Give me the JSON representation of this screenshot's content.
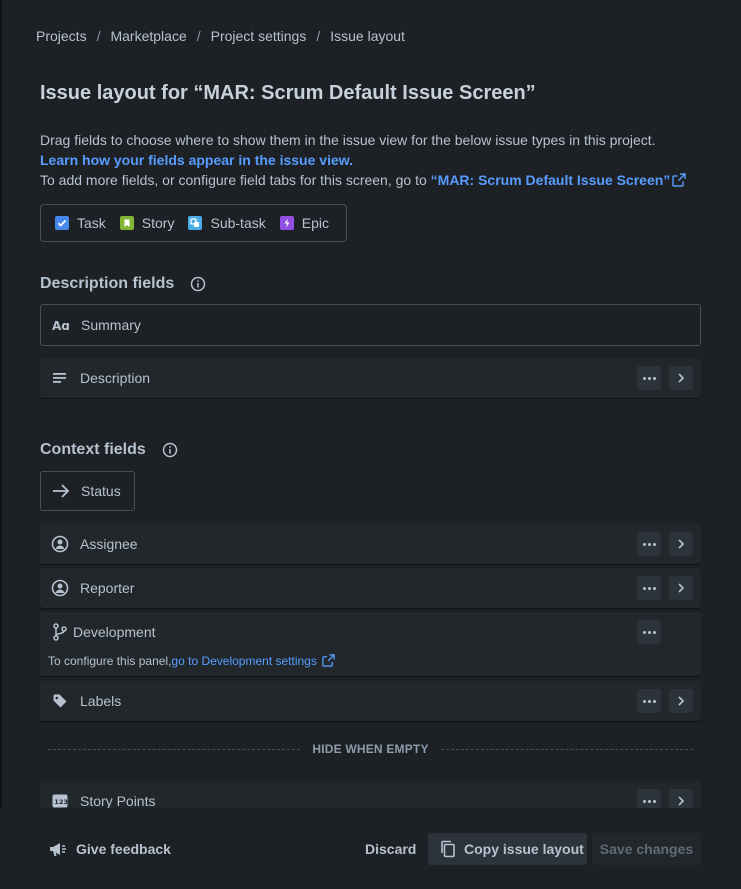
{
  "breadcrumb": [
    "Projects",
    "Marketplace",
    "Project settings",
    "Issue layout"
  ],
  "title": "Issue layout for “MAR: Scrum Default Issue Screen”",
  "intro": {
    "line1": "Drag fields to choose where to show them in the issue view for the below issue types in this project.",
    "learn_link": "Learn how your fields appear in the issue view.",
    "line3_prefix": "To add more fields, or configure field tabs for this screen, go to ",
    "screen_link": "“MAR: Scrum Default Issue Screen”"
  },
  "issue_types": [
    {
      "label": "Task",
      "color": "#4688ec",
      "icon": "task-icon"
    },
    {
      "label": "Story",
      "color": "#82b536",
      "icon": "story-icon"
    },
    {
      "label": "Sub-task",
      "color": "#4bade8",
      "icon": "subtask-icon"
    },
    {
      "label": "Epic",
      "color": "#904ee2",
      "icon": "epic-icon"
    }
  ],
  "description_section": {
    "title": "Description fields",
    "fields": [
      {
        "label": "Summary",
        "icon": "text-icon"
      },
      {
        "label": "Description",
        "icon": "paragraph-icon"
      }
    ]
  },
  "context_section": {
    "title": "Context fields",
    "status_label": "Status",
    "fields": [
      {
        "label": "Assignee",
        "icon": "person-icon"
      },
      {
        "label": "Reporter",
        "icon": "person-icon"
      },
      {
        "label": "Labels",
        "icon": "tag-icon"
      }
    ],
    "development": {
      "label": "Development",
      "note_prefix": "To configure this panel,",
      "note_link": "go to Development settings"
    }
  },
  "hide_when_empty": "HIDE WHEN EMPTY",
  "hidden_fields": [
    {
      "label": "Story Points",
      "icon": "number-icon"
    }
  ],
  "footer": {
    "feedback": "Give feedback",
    "discard": "Discard",
    "copy": "Copy issue layout",
    "save": "Save changes"
  }
}
